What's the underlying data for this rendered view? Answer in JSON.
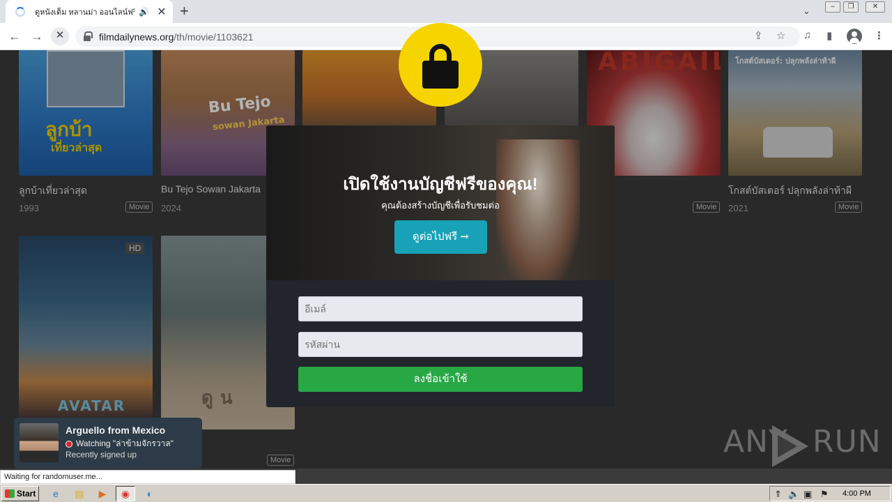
{
  "browser": {
    "tab_title": "ดูหนังเต็ม หลานม่า ออนไลน์ฟรี",
    "url_host": "filmdailynews.org",
    "url_path": "/th/movie/1103621",
    "status_text": "Waiting for randomuser.me..."
  },
  "movies": [
    {
      "title": "ลูกบ้าเที่ยวล่าสุด",
      "year": "1993",
      "badge": "Movie",
      "poster_text": "ลูกบ้า",
      "poster_subtext": "เที่ยวล่าสุด"
    },
    {
      "title": "Bu Tejo Sowan Jakarta",
      "year": "2024",
      "badge": "",
      "poster_text": "Bu Tejo",
      "poster_subtext": "sowan Jakarta"
    },
    {
      "title": "",
      "year": "",
      "badge": "Movie",
      "poster_text": "ABIGAIL",
      "poster_subtext": ""
    },
    {
      "title": "โกสต์บัสเตอร์ ปลุกพลังล่าท้าผี",
      "year": "2021",
      "badge": "Movie",
      "poster_text": "โกสต์บัสเตอร์: ปลุกพลังล่าท้าผี",
      "poster_subtext": ""
    },
    {
      "hd": "HD",
      "poster_text": "AVATAR"
    },
    {
      "poster_text": "ดูน"
    },
    {
      "badge": "Movie"
    }
  ],
  "modal": {
    "title": "เปิดใช้งานบัญชีฟรีของคุณ!",
    "subtitle": "คุณต้องสร้างบัญชีเพื่อรับชมต่อ",
    "cta_label": "ดูต่อไปฟรี ➞",
    "email_placeholder": "อีเมล์",
    "password_placeholder": "รหัสผ่าน",
    "signup_label": "ลงชื่อเข้าใช้"
  },
  "toast": {
    "name": "Arguello from Mexico",
    "watching": "Watching \"ล่าข้ามจักรวาล\"",
    "status": "Recently signed up"
  },
  "watermark": {
    "left": "ANY",
    "right": "RUN"
  },
  "taskbar": {
    "start_label": "Start",
    "clock": "4:00 PM"
  },
  "colors": {
    "accent_cta": "#17a2b8",
    "signup": "#28a745",
    "lock_circle": "#f5d400",
    "page_bg": "#3b3b3b"
  }
}
